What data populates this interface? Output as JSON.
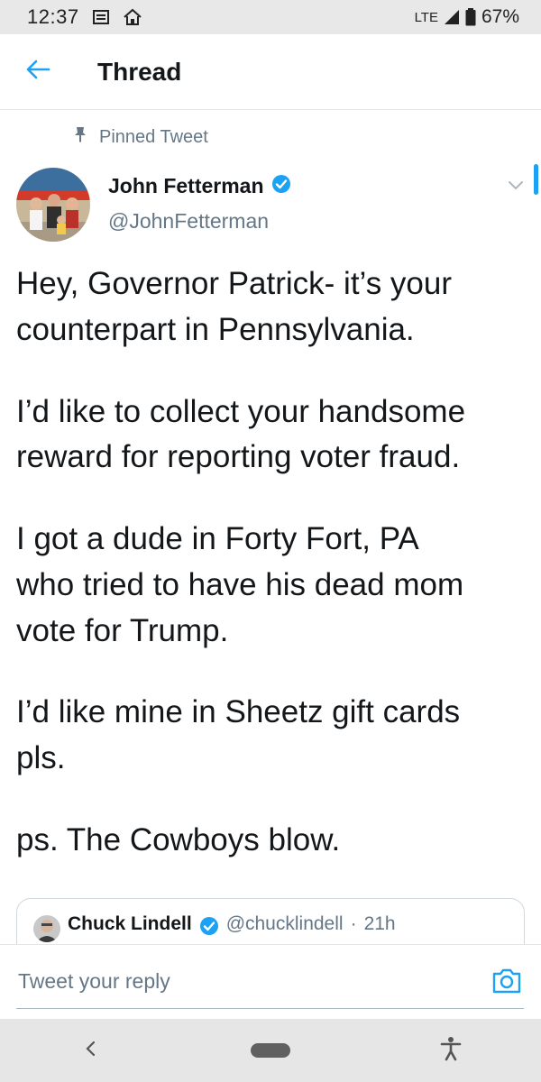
{
  "status_bar": {
    "time": "12:37",
    "network": "LTE",
    "battery": "67%",
    "icons": [
      "notification-icon",
      "home-icon",
      "signal-icon",
      "battery-icon"
    ]
  },
  "header": {
    "title": "Thread",
    "back_icon": "arrow-left-icon"
  },
  "tweet": {
    "pinned_label": "Pinned Tweet",
    "author_name": "John Fetterman",
    "author_handle": "@JohnFetterman",
    "verified": true,
    "paragraphs": [
      "Hey, Governor Patrick- it’s your\ncounterpart in Pennsylvania.",
      "I’d like to collect your handsome\nreward for reporting voter fraud.",
      "I got a dude in Forty Fort, PA\nwho tried to have his dead mom\nvote for Trump.",
      "I’d like mine in Sheetz gift cards\npls.",
      "ps.  The Cowboys blow."
    ]
  },
  "quoted_tweet": {
    "author_name": "Chuck Lindell",
    "author_handle": "@chucklindell",
    "separator": "·",
    "time": "21h",
    "verified": true
  },
  "reply": {
    "placeholder": "Tweet your reply",
    "camera_icon": "camera-icon"
  },
  "nav": {
    "back_icon": "nav-back-icon",
    "home_icon": "home-pill-icon",
    "accessibility_icon": "accessibility-icon"
  },
  "colors": {
    "accent": "#1da1f2",
    "text": "#14171a",
    "muted": "#657786"
  }
}
